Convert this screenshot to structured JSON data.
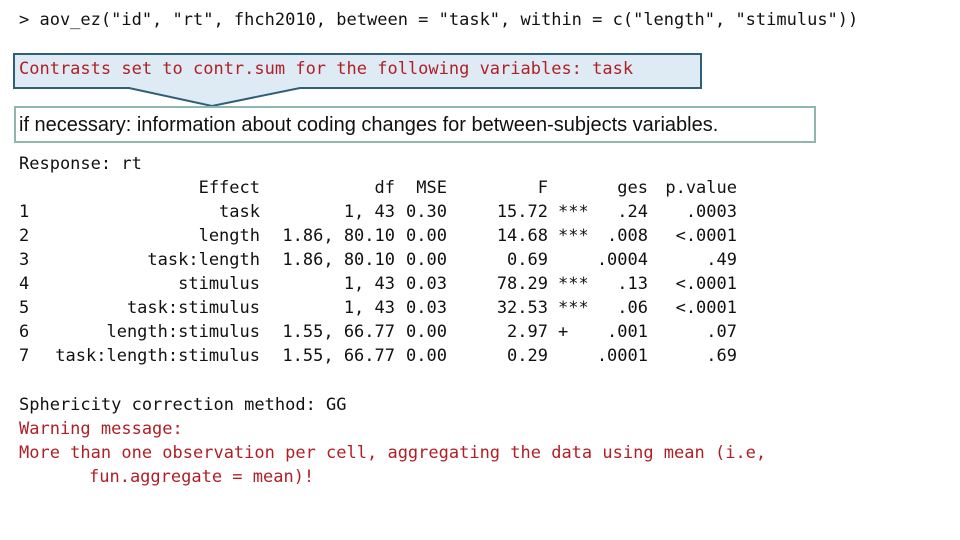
{
  "console": {
    "command": "> aov_ez(\"id\", \"rt\", fhch2010, between = \"task\", within = c(\"length\", \"stimulus\"))",
    "contrasts_message": "Contrasts set to contr.sum for the following variables: task",
    "annotation": "if necessary: information about coding changes for between-subjects variables.",
    "response_line": "Response: rt",
    "table": {
      "headers": {
        "index": "",
        "effect": "Effect",
        "df": "df",
        "mse": "MSE",
        "f": "F",
        "sig": "",
        "ges": "ges",
        "p": "p.value"
      },
      "rows": [
        {
          "index": "1",
          "effect": "task",
          "df": "1, 43",
          "mse": "0.30",
          "f": "15.72",
          "sig": "***",
          "ges": ".24",
          "p": ".0003"
        },
        {
          "index": "2",
          "effect": "length",
          "df": "1.86, 80.10",
          "mse": "0.00",
          "f": "14.68",
          "sig": "***",
          "ges": ".008",
          "p": "<.0001"
        },
        {
          "index": "3",
          "effect": "task:length",
          "df": "1.86, 80.10",
          "mse": "0.00",
          "f": "0.69",
          "sig": "",
          "ges": ".0004",
          "p": ".49"
        },
        {
          "index": "4",
          "effect": "stimulus",
          "df": "1, 43",
          "mse": "0.03",
          "f": "78.29",
          "sig": "***",
          "ges": ".13",
          "p": "<.0001"
        },
        {
          "index": "5",
          "effect": "task:stimulus",
          "df": "1, 43",
          "mse": "0.03",
          "f": "32.53",
          "sig": "***",
          "ges": ".06",
          "p": "<.0001"
        },
        {
          "index": "6",
          "effect": "length:stimulus",
          "df": "1.55, 66.77",
          "mse": "0.00",
          "f": "2.97",
          "sig": "+",
          "ges": ".001",
          "p": ".07"
        },
        {
          "index": "7",
          "effect": "task:length:stimulus",
          "df": "1.55, 66.77",
          "mse": "0.00",
          "f": "0.29",
          "sig": "",
          "ges": ".0001",
          "p": ".69"
        }
      ]
    },
    "sphericity": "Sphericity correction method: GG",
    "warning_title": "Warning message:",
    "warning_line1": "More than one observation per cell, aggregating the data using mean (i.e,",
    "warning_line2": "fun.aggregate = mean)!"
  },
  "colors": {
    "text": "#111111",
    "error_red": "#b01f24",
    "callout_fill": "#deebf5",
    "callout_border": "#2f5f78",
    "note_border": "#8fb7b0"
  }
}
